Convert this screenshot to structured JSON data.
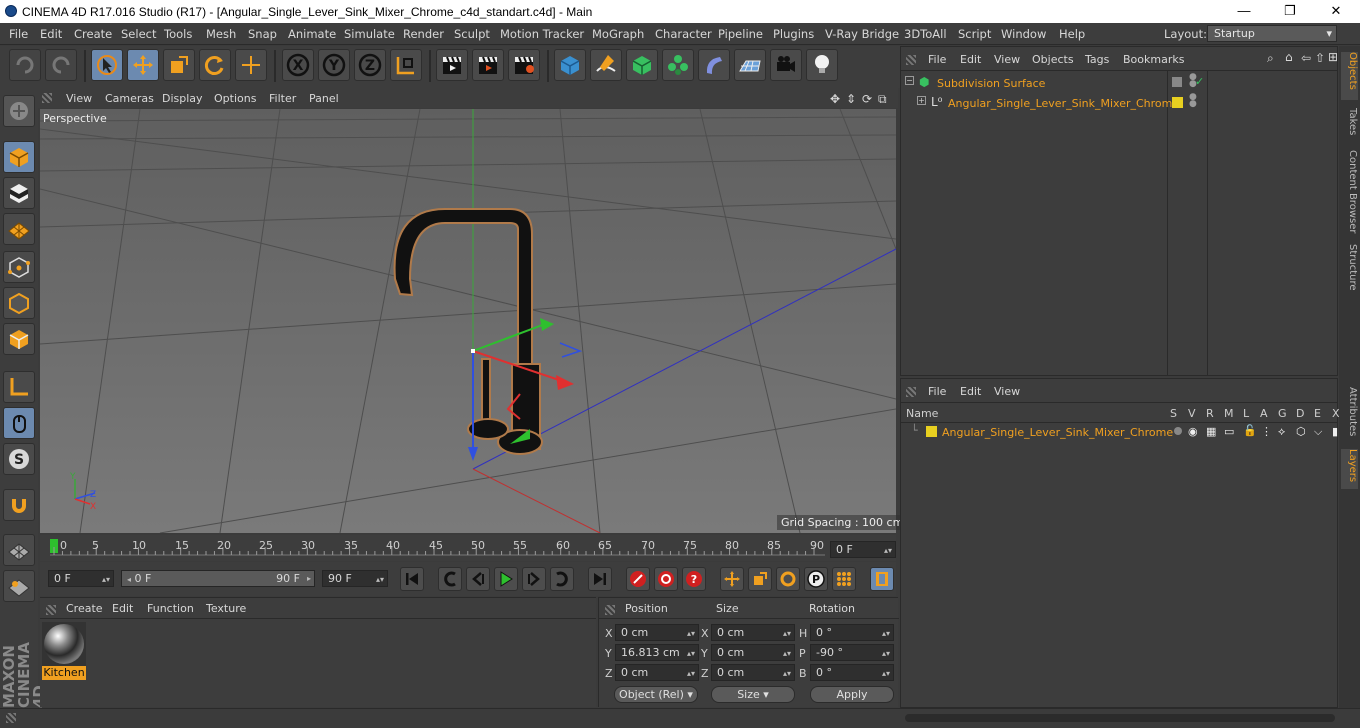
{
  "window": {
    "title": "CINEMA 4D R17.016 Studio (R17) - [Angular_Single_Lever_Sink_Mixer_Chrome_c4d_standart.c4d] - Main",
    "minimize": "—",
    "maximize": "❐",
    "close": "✕"
  },
  "menubar": {
    "items": [
      "File",
      "Edit",
      "Create",
      "Select",
      "Tools",
      "Mesh",
      "Snap",
      "Animate",
      "Simulate",
      "Render",
      "Sculpt",
      "Motion Tracker",
      "MoGraph",
      "Character",
      "Pipeline",
      "Plugins",
      "V-Ray Bridge",
      "3DToAll",
      "Script",
      "Window",
      "Help"
    ],
    "layout_label": "Layout:",
    "layout_value": "Startup"
  },
  "viewport": {
    "menu": [
      "View",
      "Cameras",
      "Display",
      "Options",
      "Filter",
      "Panel"
    ],
    "label": "Perspective",
    "grid_spacing": "Grid Spacing : 100 cm"
  },
  "timeline": {
    "ticks": [
      "0",
      "5",
      "10",
      "15",
      "20",
      "25",
      "30",
      "35",
      "40",
      "45",
      "50",
      "55",
      "60",
      "65",
      "70",
      "75",
      "80",
      "85",
      "90"
    ],
    "current_frame": "0 F"
  },
  "playback": {
    "start": "0 F",
    "range_start": "0 F",
    "range_end": "90 F",
    "end": "90 F"
  },
  "material_panel": {
    "menu": [
      "Create",
      "Edit",
      "Function",
      "Texture"
    ],
    "material_name": "Kitchen"
  },
  "coordinates": {
    "headers": [
      "Position",
      "Size",
      "Rotation"
    ],
    "rows": [
      {
        "axis": "X",
        "pos": "0 cm",
        "saxis": "X",
        "size": "0 cm",
        "raxis": "H",
        "rot": "0 °"
      },
      {
        "axis": "Y",
        "pos": "16.813 cm",
        "saxis": "Y",
        "size": "0 cm",
        "raxis": "P",
        "rot": "-90 °"
      },
      {
        "axis": "Z",
        "pos": "0 cm",
        "saxis": "Z",
        "size": "0 cm",
        "raxis": "B",
        "rot": "0 °"
      }
    ],
    "mode": "Object (Rel)",
    "size_mode": "Size",
    "apply": "Apply"
  },
  "object_manager": {
    "menu": [
      "File",
      "Edit",
      "View",
      "Objects",
      "Tags",
      "Bookmarks"
    ],
    "objects": [
      "Subdivision Surface",
      "Angular_Single_Lever_Sink_Mixer_Chrome"
    ]
  },
  "layer_manager": {
    "menu": [
      "File",
      "Edit",
      "View"
    ],
    "name_header": "Name",
    "columns": [
      "S",
      "V",
      "R",
      "M",
      "L",
      "A",
      "G",
      "D",
      "E",
      "X"
    ],
    "layer": "Angular_Single_Lever_Sink_Mixer_Chrome"
  },
  "right_tabs": [
    "Objects",
    "Takes",
    "Content Browser",
    "Structure",
    "Attributes",
    "Layers"
  ],
  "branding": "MAXON CINEMA 4D",
  "colors": {
    "accent_orange": "#f0a020",
    "active_blue": "#6c8ab0",
    "layer_yellow": "#e8d020"
  }
}
